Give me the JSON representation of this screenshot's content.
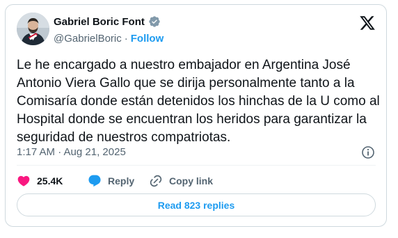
{
  "author": {
    "name": "Gabriel Boric Font",
    "handle": "@GabrielBoric",
    "separator": "·",
    "follow_label": "Follow"
  },
  "tweet": {
    "text": "Le he encargado a nuestro embajador en Argentina José Antonio Viera Gallo que se dirija personalmente tanto a la Comisaría donde están detenidos los hinchas de la U como al Hospital donde se encuentran los heridos para garantizar la seguridad de nuestros compatriotas.",
    "timestamp": "1:17 AM · Aug 21, 2025"
  },
  "actions": {
    "likes": "25.4K",
    "reply_label": "Reply",
    "copy_link_label": "Copy link"
  },
  "read_replies_label": "Read 823 replies",
  "icons": {
    "verified": "verified-badge-icon",
    "platform": "x-logo-icon",
    "info": "info-icon",
    "like": "heart-icon",
    "reply": "chat-bubble-icon",
    "copy": "link-icon"
  },
  "colors": {
    "accent": "#1d9bf0",
    "like": "#f91880",
    "text": "#0f1419",
    "muted": "#536471",
    "border": "#cfd9de"
  }
}
